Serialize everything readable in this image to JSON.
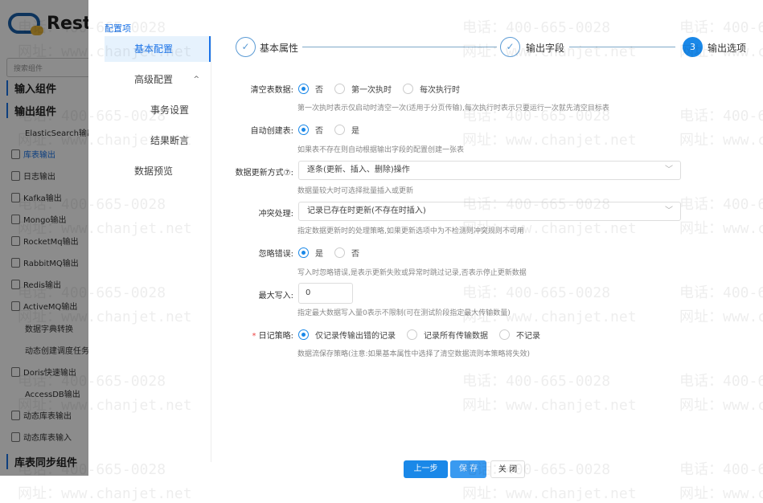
{
  "sidebar": {
    "app_name": "Resto",
    "search_placeholder": "搜索组件",
    "groups": [
      "输入组件",
      "输出组件",
      "库表同步组件"
    ],
    "items": [
      "ElasticSearch输出",
      "库表输出",
      "日志输出",
      "Kafka输出",
      "Mongo输出",
      "RocketMq输出",
      "RabbitMQ输出",
      "Redis输出",
      "ActiveMQ输出",
      "数据字典转换",
      "动态创建调度任务",
      "Doris快速输出",
      "AccessDB输出",
      "动态库表输出",
      "动态库表输入"
    ]
  },
  "modal": {
    "config_title": "配置项",
    "nav": [
      "基本配置",
      "高级配置",
      "事务设置",
      "结果断言",
      "数据预览"
    ],
    "steps": [
      {
        "label": "基本属性",
        "marker": "✓"
      },
      {
        "label": "输出字段",
        "marker": "✓"
      },
      {
        "label": "输出选项",
        "marker": "3"
      }
    ],
    "form": {
      "clear_table": {
        "label": "清空表数据:",
        "options": [
          "否",
          "第一次执时",
          "每次执行时"
        ],
        "selected": 0,
        "hint": "第一次执时表示仅启动时清空一次(适用于分页传输),每次执行时表示只要运行一次就先清空目标表"
      },
      "auto_create": {
        "label": "自动创建表:",
        "options": [
          "否",
          "是"
        ],
        "selected": 0,
        "hint": "如果表不存在则自动根据输出字段的配置创建一张表"
      },
      "update_mode": {
        "label": "数据更新方式⑦:",
        "value": "逐条(更新、插入、删除)操作",
        "hint": "数据量较大时可选择批量插入或更新"
      },
      "conflict": {
        "label": "冲突处理:",
        "value": "记录已存在时更新(不存在时插入)",
        "hint": "指定数据更新时的处理策略,如果更新选项中为不检测则冲突规则不可用"
      },
      "ignore_error": {
        "label": "忽略错误:",
        "options": [
          "是",
          "否"
        ],
        "selected": 0,
        "hint": "写入时忽略错误,是表示更新失败或异常时跳过记录,否表示停止更新数据"
      },
      "max_write": {
        "label": "最大写入:",
        "value": "0",
        "hint": "指定最大数据写入量0表示不限制(可在测试阶段指定最大传输数量)"
      },
      "log_policy": {
        "required": "*",
        "label": "日记策略:",
        "options": [
          "仅记录传输出错的记录",
          "记录所有传输数据",
          "不记录"
        ],
        "selected": 0,
        "hint": "数据流保存策略(注意:如果基本属性中选择了清空数据流则本策略将失效)"
      }
    },
    "buttons": {
      "prev": "上一步",
      "save": "保 存",
      "close": "关 闭"
    }
  },
  "watermark": {
    "phone": "电话：400-665-0028",
    "site": "网址：www.chanjet.net"
  }
}
